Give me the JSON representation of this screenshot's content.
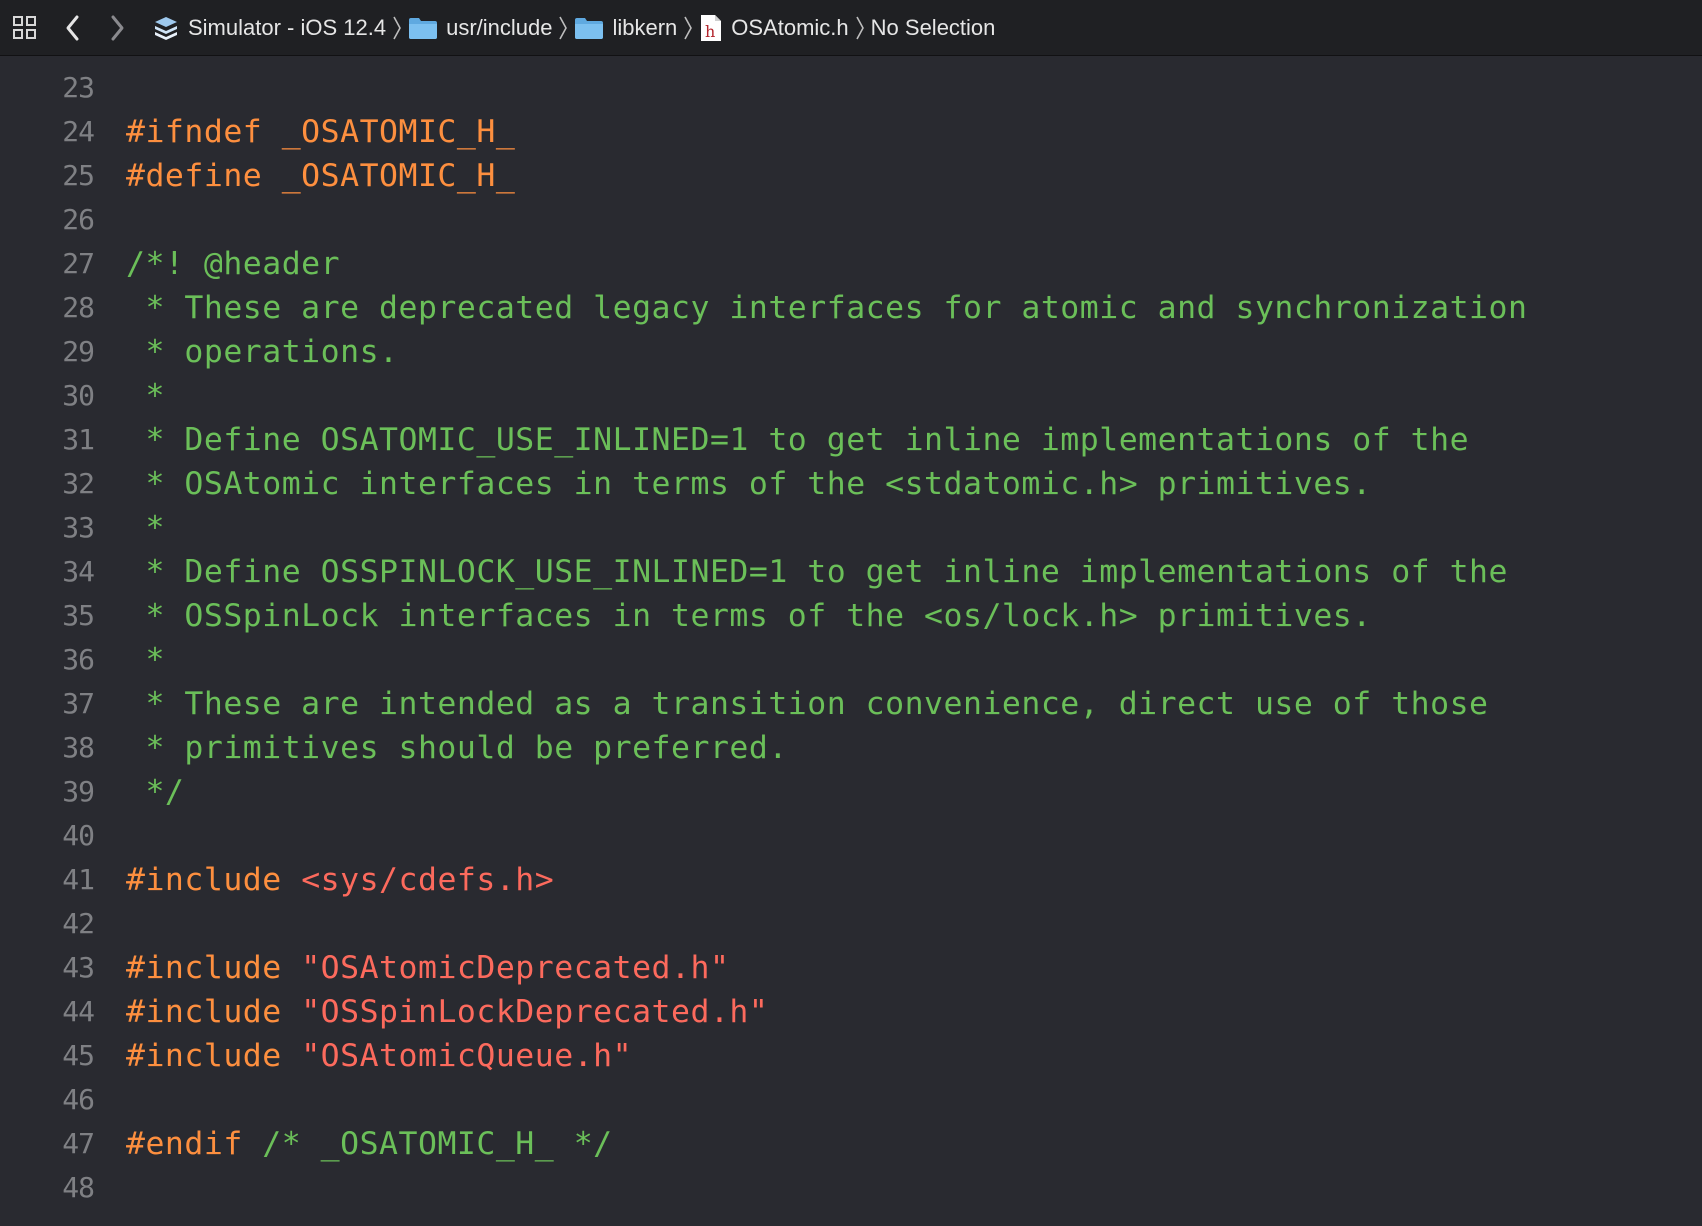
{
  "jumpbar": {
    "icons": {
      "grid": "related-items-grid-icon",
      "back": "chevron-left-icon",
      "forward": "chevron-right-icon"
    },
    "crumbs": [
      {
        "label": "Simulator - iOS 12.4",
        "icon": "sdk-stack-icon"
      },
      {
        "label": "usr/include",
        "icon": "folder-icon"
      },
      {
        "label": "libkern",
        "icon": "folder-icon"
      },
      {
        "label": "OSAtomic.h",
        "icon": "header-file-icon"
      },
      {
        "label": "No Selection",
        "icon": ""
      }
    ]
  },
  "colors": {
    "background": "#292a30",
    "jumpbar_background": "#1f2023",
    "line_number": "#7f8084",
    "preprocessor": "#fd8f3f",
    "comment": "#6bbf59",
    "string": "#fc6a5d",
    "folder": "#6cb4e8"
  },
  "editor": {
    "lines": [
      {
        "n": "23",
        "tokens": []
      },
      {
        "n": "24",
        "tokens": [
          {
            "t": "pre",
            "v": "#ifndef _OSATOMIC_H_"
          }
        ]
      },
      {
        "n": "25",
        "tokens": [
          {
            "t": "pre",
            "v": "#define _OSATOMIC_H_"
          }
        ]
      },
      {
        "n": "26",
        "tokens": []
      },
      {
        "n": "27",
        "tokens": [
          {
            "t": "cmt",
            "v": "/*! @header"
          }
        ]
      },
      {
        "n": "28",
        "tokens": [
          {
            "t": "cmt",
            "v": " * These are deprecated legacy interfaces for atomic and synchronization"
          }
        ]
      },
      {
        "n": "29",
        "tokens": [
          {
            "t": "cmt",
            "v": " * operations."
          }
        ]
      },
      {
        "n": "30",
        "tokens": [
          {
            "t": "cmt",
            "v": " *"
          }
        ]
      },
      {
        "n": "31",
        "tokens": [
          {
            "t": "cmt",
            "v": " * Define OSATOMIC_USE_INLINED=1 to get inline implementations of the"
          }
        ]
      },
      {
        "n": "32",
        "tokens": [
          {
            "t": "cmt",
            "v": " * OSAtomic interfaces in terms of the <stdatomic.h> primitives."
          }
        ]
      },
      {
        "n": "33",
        "tokens": [
          {
            "t": "cmt",
            "v": " *"
          }
        ]
      },
      {
        "n": "34",
        "tokens": [
          {
            "t": "cmt",
            "v": " * Define OSSPINLOCK_USE_INLINED=1 to get inline implementations of the"
          }
        ]
      },
      {
        "n": "35",
        "tokens": [
          {
            "t": "cmt",
            "v": " * OSSpinLock interfaces in terms of the <os/lock.h> primitives."
          }
        ]
      },
      {
        "n": "36",
        "tokens": [
          {
            "t": "cmt",
            "v": " *"
          }
        ]
      },
      {
        "n": "37",
        "tokens": [
          {
            "t": "cmt",
            "v": " * These are intended as a transition convenience, direct use of those"
          }
        ]
      },
      {
        "n": "38",
        "tokens": [
          {
            "t": "cmt",
            "v": " * primitives should be preferred."
          }
        ]
      },
      {
        "n": "39",
        "tokens": [
          {
            "t": "cmt",
            "v": " */"
          }
        ]
      },
      {
        "n": "40",
        "tokens": []
      },
      {
        "n": "41",
        "tokens": [
          {
            "t": "pre",
            "v": "#include "
          },
          {
            "t": "str",
            "v": "<sys/cdefs.h>"
          }
        ]
      },
      {
        "n": "42",
        "tokens": []
      },
      {
        "n": "43",
        "tokens": [
          {
            "t": "pre",
            "v": "#include "
          },
          {
            "t": "str",
            "v": "\"OSAtomicDeprecated.h\""
          }
        ]
      },
      {
        "n": "44",
        "tokens": [
          {
            "t": "pre",
            "v": "#include "
          },
          {
            "t": "str",
            "v": "\"OSSpinLockDeprecated.h\""
          }
        ]
      },
      {
        "n": "45",
        "tokens": [
          {
            "t": "pre",
            "v": "#include "
          },
          {
            "t": "str",
            "v": "\"OSAtomicQueue.h\""
          }
        ]
      },
      {
        "n": "46",
        "tokens": []
      },
      {
        "n": "47",
        "tokens": [
          {
            "t": "pre",
            "v": "#endif "
          },
          {
            "t": "cmt",
            "v": "/* _OSATOMIC_H_ */"
          }
        ]
      },
      {
        "n": "48",
        "tokens": []
      }
    ]
  }
}
